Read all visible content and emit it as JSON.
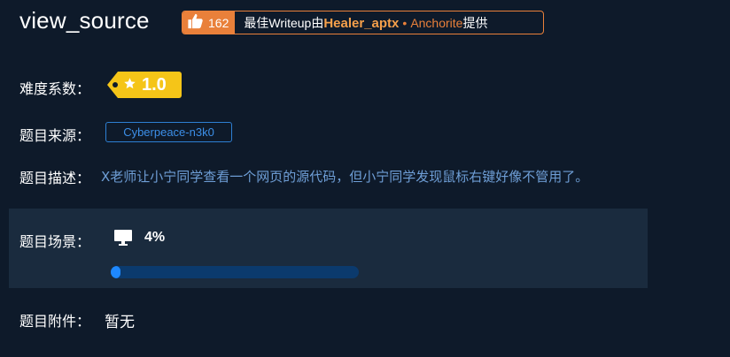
{
  "challenge": {
    "title": "view_source"
  },
  "writeup": {
    "likes": "162",
    "prefix": "最佳Writeup由",
    "author": "Healer_aptx",
    "dot": "•",
    "team": "Anchorite",
    "suffix": "提供",
    "accent_color": "#e9803a"
  },
  "difficulty": {
    "label": "难度系数：",
    "value": "1.0",
    "icon": "star-icon",
    "color": "#f5c518"
  },
  "source": {
    "label": "题目来源：",
    "value": "Cyberpeace-n3k0"
  },
  "description": {
    "label": "题目描述：",
    "value": "X老师让小宁同学查看一个网页的源代码，但小宁同学发现鼠标右键好像不管用了。"
  },
  "scene": {
    "label": "题目场景：",
    "icon": "monitor-icon",
    "percent": "4%",
    "progress": 0.04
  },
  "attachment": {
    "label": "题目附件：",
    "value": "暂无"
  }
}
